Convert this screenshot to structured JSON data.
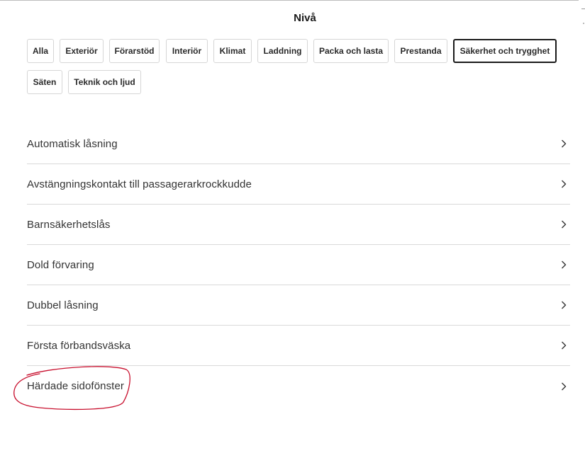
{
  "header": {
    "title": "Nivå"
  },
  "filters": {
    "chips": [
      {
        "label": "Alla",
        "active": false
      },
      {
        "label": "Exteriör",
        "active": false
      },
      {
        "label": "Förarstöd",
        "active": false
      },
      {
        "label": "Interiör",
        "active": false
      },
      {
        "label": "Klimat",
        "active": false
      },
      {
        "label": "Laddning",
        "active": false
      },
      {
        "label": "Packa och lasta",
        "active": false
      },
      {
        "label": "Prestanda",
        "active": false
      },
      {
        "label": "Säkerhet och trygghet",
        "active": true
      },
      {
        "label": "Säten",
        "active": false
      },
      {
        "label": "Teknik och ljud",
        "active": false
      }
    ]
  },
  "features": {
    "items": [
      {
        "label": "Automatisk låsning"
      },
      {
        "label": "Avstängningskontakt till passagerarkrockkudde"
      },
      {
        "label": "Barnsäkerhetslås"
      },
      {
        "label": "Dold förvaring"
      },
      {
        "label": "Dubbel låsning"
      },
      {
        "label": "Första förbandsväska"
      },
      {
        "label": "Härdade sidofönster"
      }
    ],
    "chevron_icon": "chevron-right-icon"
  },
  "annotation": {
    "shape": "hand-drawn-circle",
    "color": "#c8102e",
    "target": "Härdade sidofönster"
  }
}
